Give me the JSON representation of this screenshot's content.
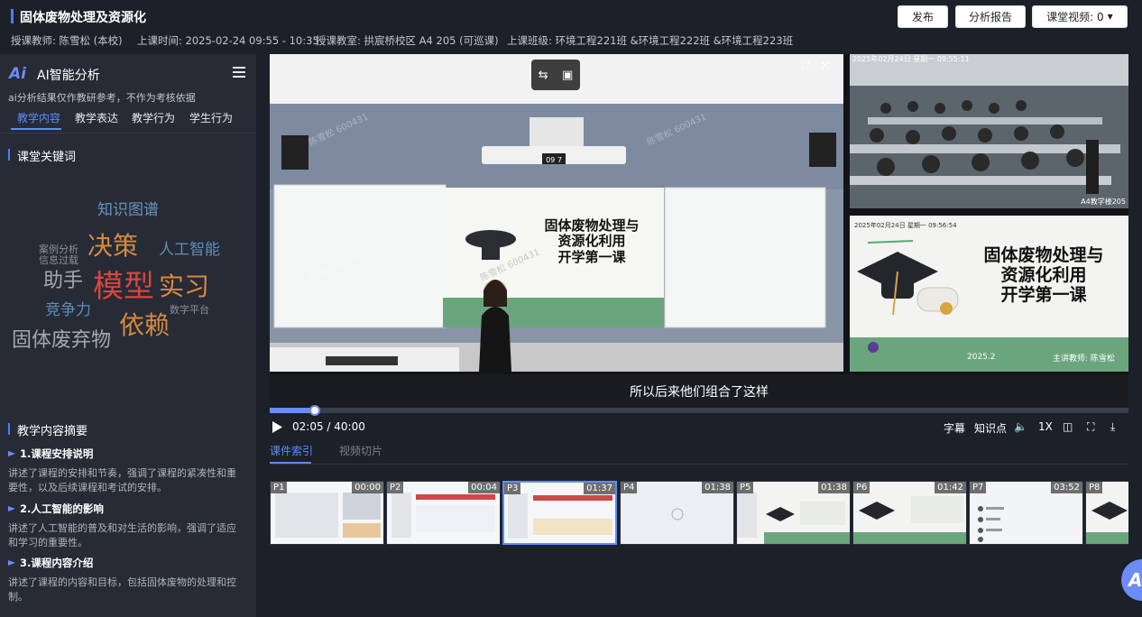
{
  "header": {
    "title": "固体废物处理及资源化",
    "teacher": "授课教师: 陈雪松 (本校)",
    "time": "上课时间: 2025-02-24 09:55 - 10:35",
    "room": "授课教室: 拱宸桥校区 A4 205 (可巡课)",
    "classes": "上课班级: 环境工程221班 &环境工程222班 &环境工程223班",
    "buttons": {
      "publish": "发布",
      "report": "分析报告",
      "video": "课堂视频: 0"
    }
  },
  "sidebar": {
    "logo": "Ai",
    "title": "AI智能分析",
    "note": "ai分析结果仅作教研参考，不作为考核依据",
    "tabs": [
      "教学内容",
      "教学表达",
      "教学行为",
      "学生行为"
    ],
    "keywords_title": "课堂关键词",
    "keywords": [
      {
        "text": "知识图谱",
        "color": "#6b93b8"
      },
      {
        "text": "案例分析",
        "color": "#8a8f99"
      },
      {
        "text": "信息过载",
        "color": "#8a8f99"
      },
      {
        "text": "决策",
        "color": "#d7893f"
      },
      {
        "text": "人工智能",
        "color": "#5f8db3"
      },
      {
        "text": "助手",
        "color": "#a3a8b2"
      },
      {
        "text": "模型",
        "color": "#d6463d"
      },
      {
        "text": "实习",
        "color": "#d7893f"
      },
      {
        "text": "竞争力",
        "color": "#5f8db3"
      },
      {
        "text": "数字平台",
        "color": "#8a8f99"
      },
      {
        "text": "依赖",
        "color": "#d7893f"
      },
      {
        "text": "固体废弃物",
        "color": "#a3a8b2"
      }
    ],
    "summary_title": "教学内容摘要",
    "summary": [
      {
        "head": "1.课程安排说明",
        "text": "讲述了课程的安排和节奏，强调了课程的紧凑性和重要性，以及后续课程和考试的安排。"
      },
      {
        "head": "2.人工智能的影响",
        "text": "讲述了人工智能的普及和对生活的影响，强调了适应和学习的重要性。"
      },
      {
        "head": "3.课程内容介绍",
        "text": "讲述了课程的内容和目标，包括固体废物的处理和控制。"
      }
    ]
  },
  "player": {
    "slide_title": "固体废物处理与\n资源化利用\n开学第一课",
    "cam_timestamp": "2025年02月24日 星期一 09:55:11",
    "cam_label": "A4教学楼205",
    "slide_timestamp": "2025年02月24日 星期一 09:56:54",
    "slide_date": "2025.2",
    "slide_teacher": "主讲教师: 陈雪松",
    "projector_counter": "09 7",
    "watermark": "陈雪松 600431",
    "subtitle": "所以后来他们组合了这样",
    "progress": 0.052,
    "current_time": "02:05",
    "total_time": "40:00",
    "controls": {
      "subtitles": "字幕",
      "knowledge": "知识点",
      "speed": "1X"
    }
  },
  "bottom": {
    "tabs": [
      "课件索引",
      "视频切片"
    ],
    "thumbs": [
      {
        "page": "P1",
        "time": "00:00"
      },
      {
        "page": "P2",
        "time": "00:04"
      },
      {
        "page": "P3",
        "time": "01:37"
      },
      {
        "page": "P4",
        "time": "01:38"
      },
      {
        "page": "P5",
        "time": "01:38"
      },
      {
        "page": "P6",
        "time": "01:42"
      },
      {
        "page": "P7",
        "time": "03:52"
      },
      {
        "page": "P8",
        "time": ""
      }
    ]
  },
  "floating": {
    "label": "Ai"
  },
  "colors": {
    "accent": "#5b8cff",
    "slide_green": "#6aa57e"
  }
}
